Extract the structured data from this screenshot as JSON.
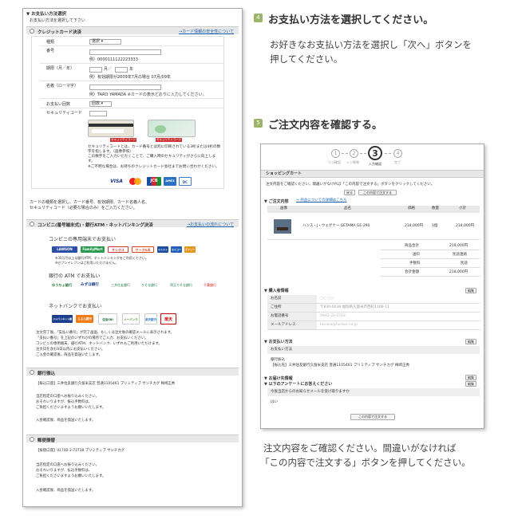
{
  "step4": {
    "num": "4",
    "title": "お支払い方法を選択してください。",
    "desc1": "お好きなお支払い方法を選択し「次へ」ボタンを",
    "desc2": "押してください。"
  },
  "step5": {
    "num": "5",
    "title": "ご注文内容を確認する。",
    "desc1": "注文内容をご確認ください。間違いがなければ",
    "desc2": "「この内容で注文する」ボタンを押してください。"
  },
  "left": {
    "header": "▼ お支払い方法選択",
    "subheader": "お支払い方法を選択して下さい",
    "credit": {
      "label": "クレジットカード決済",
      "link": "→カード情報の安全性について",
      "type_label": "種類",
      "type_value": "選択",
      "number_label": "番号",
      "number_example": "例）0000111122223333",
      "expiry_label": "期限（月／年）",
      "expiry_month": "月／",
      "expiry_year": "年",
      "expiry_example": "例）有効期限が2009年7月の場合 07月/09年",
      "name_label": "名義（ローマ字）",
      "name_example": "例）TARO YAMADA ※カードの表示どおりに入力してください。",
      "payment_label": "お支払い回数",
      "payment_value": "回数",
      "security_label": "セキュリティコード",
      "security_tag": "セキュリティコード",
      "security_note1": "セキュリティコードとは、カード番号とは別に印刷されている3桁または4桁の数",
      "security_note2": "字を指します。（画像参照）",
      "security_note3": "この数字をご入力いただくことで、ご購入時のセキュリティがさらに向上しま",
      "security_note4": "す。",
      "security_note5": "※ご不明な場合は、お持ちのクレジットカード会社までお問い合わせください。",
      "logos": [
        "VISA",
        "MC",
        "JCB",
        "AMEX",
        "DC"
      ],
      "foot1": "カードの種類を選択し、カード番号、有効期限、カード名義人名、",
      "foot2": "セキュリティコード（必要な場合のみ）をご入力ください。"
    },
    "conv": {
      "label": "コンビニ(番号端末式)・銀行ATM・ネットバンキング決済",
      "link": "→お支払いの流れについて",
      "shop_title": "コンビニの専用端末でお支払い",
      "shops": [
        "LAWSON",
        "FamilyMart",
        "サンクス",
        "サークルK",
        "ミニストップ",
        "セイコーマート",
        "デイリー"
      ],
      "shop_note1": "※30万円以上は銀行ATM、ネットバンキングをご利用ください。",
      "shop_note2": "※セブンイレブンはご利用いただけません。",
      "atm_title": "銀行の ATM でお支払い",
      "atms": [
        "ゆうちょ銀行",
        "みずほ銀行",
        "三井住友銀行",
        "りそな銀行",
        "埼玉りそな銀行",
        "千葉銀行"
      ],
      "net_title": "ネットバンクでお支払い",
      "nets": [
        "ジャパンネット銀行",
        "じぶん銀行",
        "住信SBI",
        "イーバンク",
        "楽天銀行",
        "楽天"
      ],
      "note1": "注文完了後、「支払い番号」が完了画面、もしくは注文後の確認メールに表示されます。",
      "note2": "「支払い番号」を上記のいずれかの場所でご入力、お支払いください。",
      "note3": "コンビニの専用端末、銀行ATM、ネットバンク、いずれもご利用いただけます。",
      "note4": "注文日を含む6日以内にお支払いください。",
      "note5": "ご入金の確認後、商品を発送いたします。"
    },
    "bank": {
      "label": "銀行振込",
      "account": "【振込口座】三井住友銀行久留米支店 普通1105461 プリミティブ サンチカグ 梅崎正秀",
      "note1": "当店指定の口座へお振り込みください。",
      "note2": "おそれいりますが、振込手数料は、",
      "note3": "ご負担くださいますようお願いいたします。",
      "note4": "入金確認後、商品を発送いたします。"
    },
    "postal": {
      "label": "郵便振替",
      "account": "【振替口座】01700-3-72738 プリミティブ サンチカグ",
      "note1": "当店指定の口座へお振り込みください。",
      "note2": "おそれいりますが、払込手数料は、",
      "note3": "ご負担くださいますようお願いいたします。",
      "note4": "入金確認後、商品を発送いたします。"
    }
  },
  "right": {
    "steps": [
      "カゴ確認",
      "レジ情報",
      "入力確認",
      "完了"
    ],
    "current_step": "3",
    "cart_title": "ショッピングカート",
    "intro": "注文内容をご確認ください。間違いがなければ「この内容で注文する」ボタンをクリックしてください。",
    "back_btn": "戻る",
    "order_btn": "この内容で注文する",
    "order_hd": "▼ ご注文内容",
    "order_link": "→ 商品についての詳細はこちら",
    "cols": [
      "画像",
      "品名",
      "価格",
      "数量",
      "小計"
    ],
    "item": {
      "name": "ハンス・J・ウェグナー GETAMA GE-290",
      "price": "218,000円",
      "qty": "1個",
      "subtotal": "218,000円"
    },
    "totals": [
      {
        "k": "商品合計",
        "v": "218,000円"
      },
      {
        "k": "送料",
        "v": "別途連絡"
      },
      {
        "k": "手数料",
        "v": "別途"
      },
      {
        "k": "合計金額",
        "v": "218,000円"
      }
    ],
    "buyer_hd": "▼ 購入者情報",
    "edit": "編集",
    "buyer": [
      {
        "k": "お名前",
        "v": "○○ ○○"
      },
      {
        "k": "ご住所",
        "v": "〒830-0038 福岡県久留米市西町1166-11"
      },
      {
        "k": "お電話番号",
        "v": "0942-32-0702"
      },
      {
        "k": "メールアドレス",
        "v": "tanaka@harbor.ne.jp"
      }
    ],
    "pay_hd": "▼ お支払い方法",
    "pay_label": "お支払い方法",
    "pay_v1": "銀行振込",
    "pay_v2": "【振込先】三井住友銀行久留米支店 普通1105461 プリミティブ サンチカグ 梅崎正秀",
    "deliv_hd": "▼ お届け先情報",
    "survey_hd": "▼ 以下のアンケートにお答えください",
    "survey_q": "今後当店からのお知らせメールを受け取りますか",
    "survey_a": "はい",
    "order_btn2": "この内容で注文する"
  }
}
